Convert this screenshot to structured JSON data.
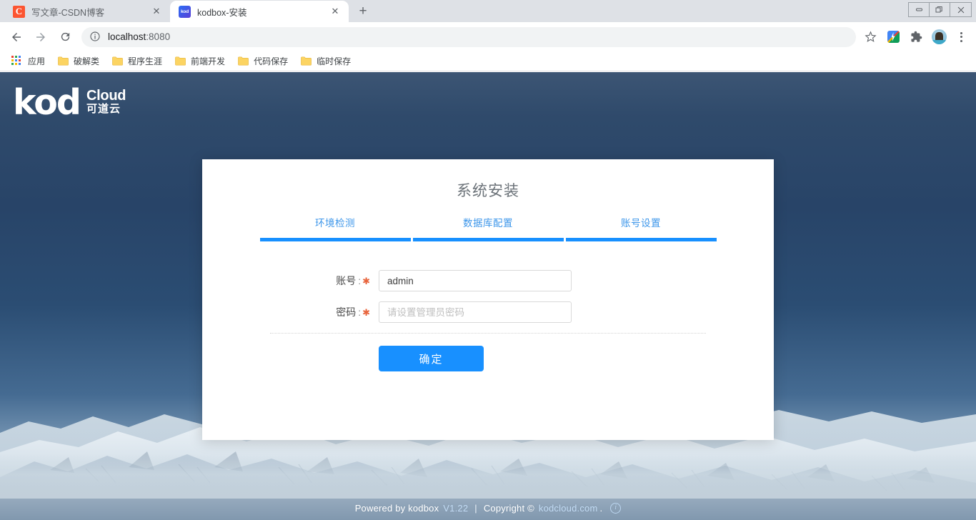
{
  "browser": {
    "tabs": [
      {
        "title": "写文章-CSDN博客",
        "favicon": "csdn-icon",
        "active": false,
        "close_label": "✕"
      },
      {
        "title": "kodbox-安装",
        "favicon": "kodbox-icon",
        "active": true,
        "close_label": "✕"
      }
    ],
    "new_tab_label": "+",
    "window_controls": {
      "minimize": "minimize-icon",
      "restore": "restore-icon",
      "close": "close-icon"
    },
    "toolbar": {
      "back": "back-arrow-icon",
      "forward": "forward-arrow-icon",
      "reload": "reload-icon",
      "site_info": "info-icon",
      "url_host": "localhost",
      "url_port": ":8080",
      "bookmark_star": "star-icon",
      "extensions": [
        "google-photos-icon",
        "puzzle-extension-icon",
        "profile-avatar-icon"
      ],
      "menu": "three-dot-menu-icon"
    },
    "bookmarks": [
      {
        "label": "应用",
        "icon": "apps-grid-icon"
      },
      {
        "label": "破解类",
        "icon": "folder-icon"
      },
      {
        "label": "程序生涯",
        "icon": "folder-icon"
      },
      {
        "label": "前端开发",
        "icon": "folder-icon"
      },
      {
        "label": "代码保存",
        "icon": "folder-icon"
      },
      {
        "label": "临时保存",
        "icon": "folder-icon"
      }
    ]
  },
  "page": {
    "logo": {
      "word": "kod",
      "cloud": "Cloud",
      "chinese": "可道云"
    },
    "card": {
      "title": "系统安装",
      "steps": [
        {
          "label": "环境检测",
          "done": true
        },
        {
          "label": "数据库配置",
          "done": true
        },
        {
          "label": "账号设置",
          "done": true
        }
      ],
      "fields": [
        {
          "label": "账号",
          "colon": ":",
          "required_mark": "✱",
          "value": "admin",
          "placeholder": ""
        },
        {
          "label": "密码",
          "colon": ":",
          "required_mark": "✱",
          "value": "",
          "placeholder": "请设置管理员密码"
        }
      ],
      "submit_label": "确定"
    },
    "footer": {
      "powered_by": "Powered by kodbox",
      "version": "V1.22",
      "separator": "|",
      "copyright": "Copyright ©",
      "site": "kodcloud.com",
      "period": ".",
      "info_icon": "info-circle-icon"
    }
  },
  "colors": {
    "accent_blue": "#1890ff",
    "step_text": "#3c96ea",
    "required_star": "#e8643c",
    "card_bg": "#ffffff",
    "sky_top": "#3c5574",
    "sky_mid": "#284468"
  }
}
